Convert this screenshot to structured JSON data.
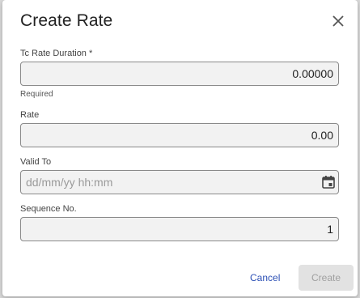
{
  "dialog": {
    "title": "Create Rate",
    "cancel_label": "Cancel",
    "create_label": "Create"
  },
  "fields": {
    "tc_rate_duration": {
      "label": "Tc Rate Duration *",
      "value": "0.00000",
      "hint": "Required"
    },
    "rate": {
      "label": "Rate",
      "value": "0.00"
    },
    "valid_to": {
      "label": "Valid To",
      "placeholder": "dd/mm/yy hh:mm",
      "value": ""
    },
    "sequence_no": {
      "label": "Sequence No.",
      "value": "1"
    }
  },
  "icons": {
    "close": "close-icon",
    "calendar": "calendar-icon"
  },
  "colors": {
    "link": "#2b4fb5",
    "disabled_button_bg": "#e2e2e2",
    "disabled_button_text": "#a0a0a0"
  }
}
